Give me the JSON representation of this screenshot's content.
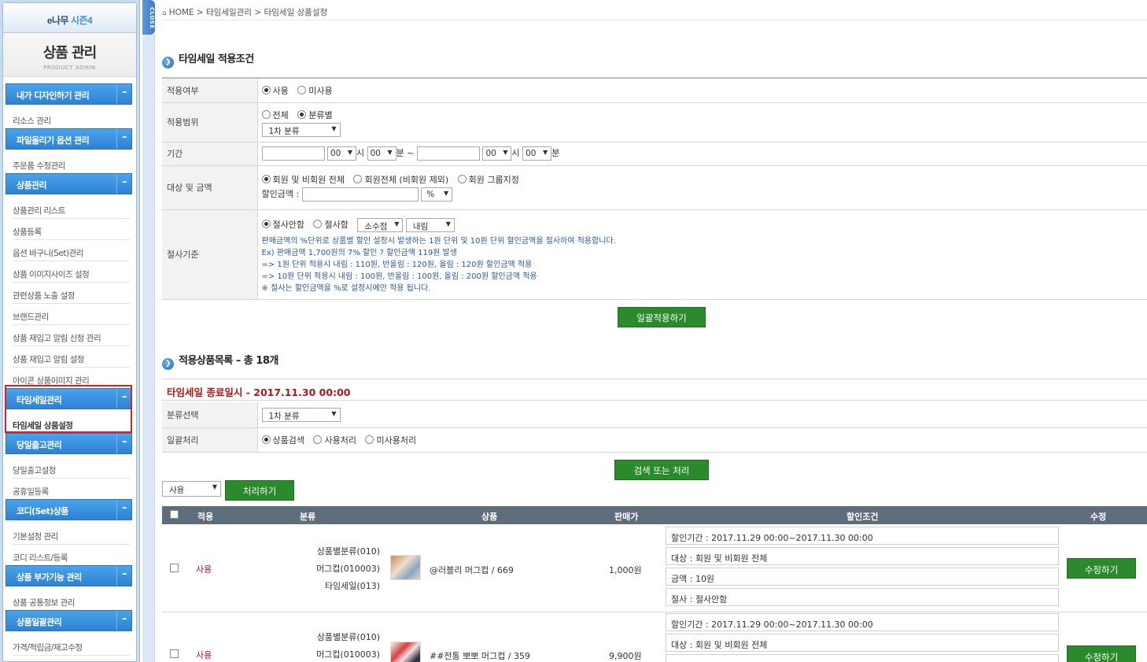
{
  "sidebar": {
    "brand": "e나무",
    "brand_season": "시즌4",
    "title": "상품 관리",
    "subtitle": "PRODUCT ADMIN",
    "close_tab": "CLOSE",
    "groups": [
      {
        "label": "내가 디자인하기 관리",
        "toggle": "–"
      },
      {
        "label": "파일올리기 옵션 관리",
        "toggle": "–"
      },
      {
        "label": "상품관리",
        "toggle": "–"
      },
      {
        "label": "타임세일관리",
        "toggle": "–"
      },
      {
        "label": "당일출고관리",
        "toggle": "–"
      },
      {
        "label": "코디(Set)상품",
        "toggle": "–"
      },
      {
        "label": "상품 부가기능 관리",
        "toggle": "–"
      },
      {
        "label": "상품일괄관리",
        "toggle": "–"
      }
    ],
    "items": [
      "리소스 관리",
      "주문품 수정관리",
      "상품관리 리스트",
      "상품등록",
      "옵션 바구니(Set)관리",
      "상품 이미지사이즈 설정",
      "관련상품 노출 설정",
      "브랜드관리",
      "상품 재입고 알림 신청 관리",
      "상품 재입고 알림 설정",
      "아이콘 상품이미지 관리",
      "타임세일 상품설정",
      "당일출고설정",
      "공휴일등록",
      "기본설정 관리",
      "코디 리스트/등록",
      "상품 공통정보 관리",
      "가격/적립금/재고수정"
    ]
  },
  "breadcrumb": {
    "home": "HOME",
    "sep": ">",
    "level1": "타임세일관리",
    "level2": "타임세일 상품설정"
  },
  "conditions": {
    "title": "타임세일 적용조건",
    "apply": {
      "label": "적용여부",
      "opt_use": "사용",
      "opt_unuse": "미사용"
    },
    "range": {
      "label": "적용범위",
      "opt_all": "전체",
      "opt_cat": "분류별",
      "select": "1차 분류"
    },
    "period": {
      "label": "기간",
      "hour1": "00",
      "min1": "00",
      "hour2": "00",
      "min2": "00",
      "h": "시",
      "m": "분",
      "tilde": "~"
    },
    "target": {
      "label": "대상 및 금액",
      "opt1": "회원 및 비회원 전체",
      "opt2": "회원전체 (비회원 제외)",
      "opt3": "회원 그룹지정",
      "amount_label": "할인금액 :",
      "unit": "%"
    },
    "cut": {
      "label": "절사기준",
      "opt_no": "절사안함",
      "opt_yes": "절사함",
      "sel_point": "소수점",
      "sel_dir": "내림",
      "note1": "판매금액의 %단위로 상품별 할인 설정시 발생하는 1원 단위 및 10원 단위 할인금액을 절사하여 적용합니다.",
      "note2": "Ex) 판매금액 1,700원의 7% 할인 ? 할인금액 119원 발생",
      "note3": "=> 1원 단위 적용시 내림 : 110원, 반올림 : 120원, 올림 : 120원 할인금액 적용",
      "note4": "=> 10원 단위 적용시 내림 : 100원, 반올림 : 100원, 올림 : 200원 할인금액 적용",
      "note5": "※ 절사는 할인금액을 %로 설정시에만 적용 됩니다."
    },
    "apply_button": "일괄적용하기"
  },
  "products": {
    "title": "적용상품목록 – 총 18개",
    "end_time": "타임세일 종료일시 - 2017.11.30 00:00",
    "category": {
      "label": "분류선택",
      "select": "1차 분류"
    },
    "bulk": {
      "label": "일괄처리",
      "opt1": "상품검색",
      "opt2": "사용처리",
      "opt3": "미사용처리"
    },
    "search_button": "검색 또는 처리",
    "action_select": "사용",
    "process_button": "처리하기",
    "columns": {
      "apply": "적용",
      "category": "분류",
      "product": "상품",
      "price": "판매가",
      "condition": "할인조건",
      "edit": "수정"
    },
    "rows": [
      {
        "status": "사용",
        "cat1": "상품별분류(010)",
        "cat2": "머그컵(010003)",
        "cat3": "타임세일(013)",
        "name": "@러블리 머그컵 / 669",
        "price": "1,000원",
        "cond1": "할인기간 : 2017.11.29 00:00~2017.11.30 00:00",
        "cond2": "대상 : 회원 및 비회원 전체",
        "cond3": "금액 : 10원",
        "cond4": "절사 : 절사안함",
        "edit": "수정하기"
      },
      {
        "status": "사용",
        "cat1": "상품별분류(010)",
        "cat2": "머그컵(010003)",
        "name": "##전통 뽀뽀 머그컵 / 359",
        "price": "9,900원",
        "cond1": "할인기간 : 2017.11.29 00:00~2017.11.30 00:00",
        "cond2": "대상 : 회원 및 비회원 전체",
        "edit": "수정하기"
      }
    ]
  }
}
